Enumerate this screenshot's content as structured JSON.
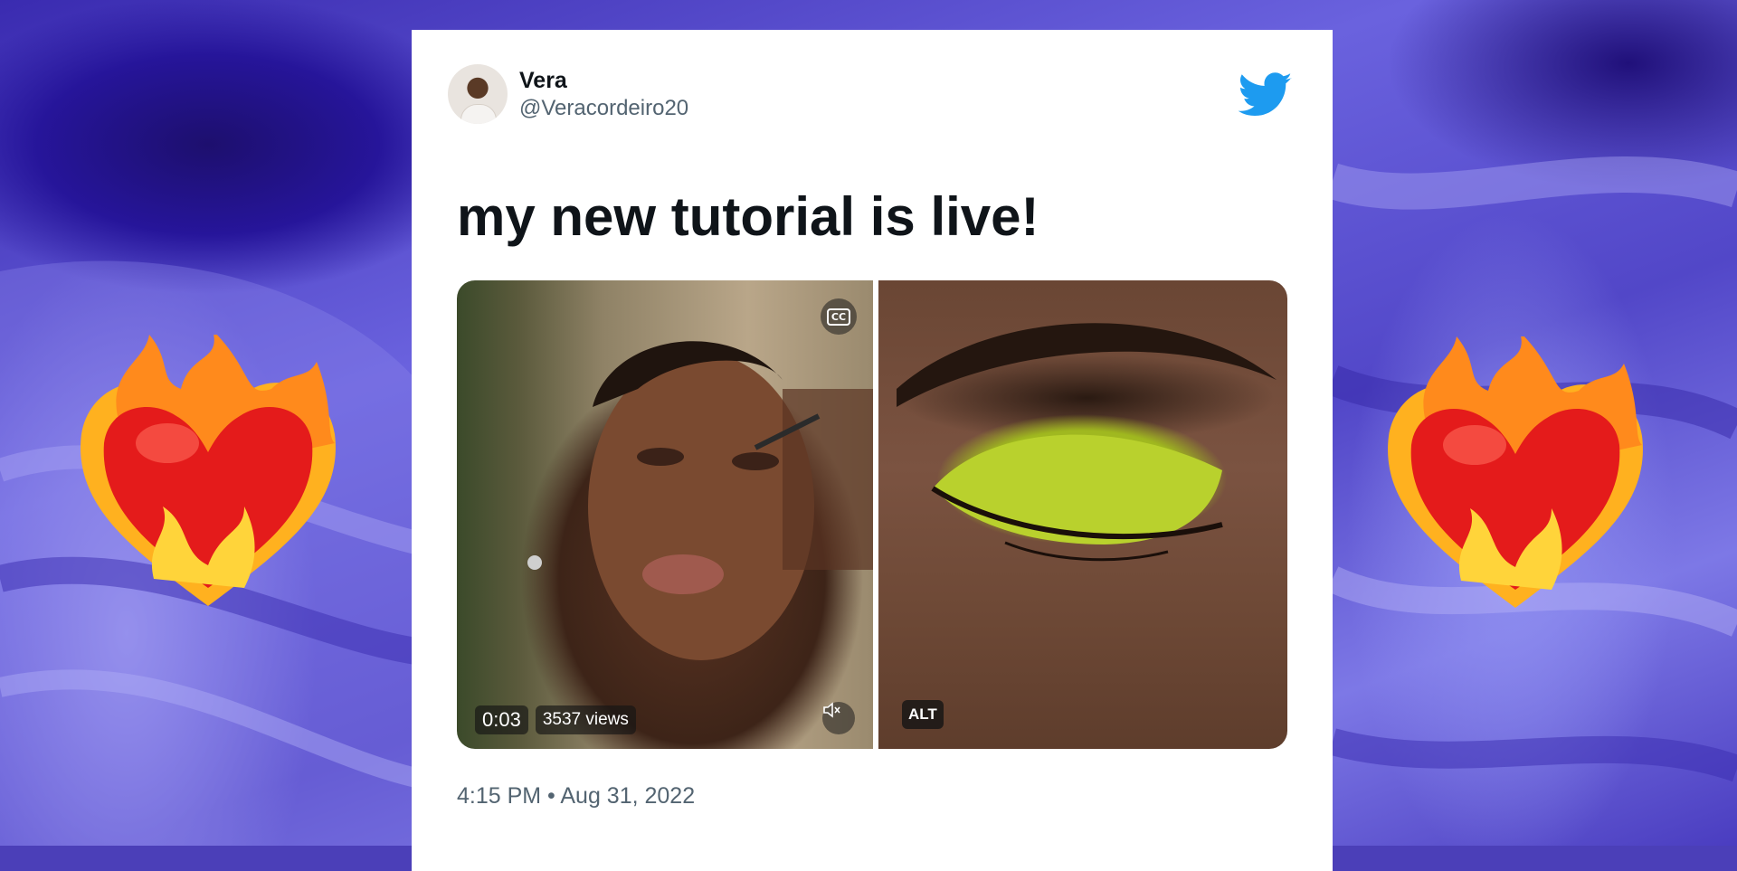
{
  "tweet": {
    "author_name": "Vera",
    "author_handle": "@Veracordeiro20",
    "text": "my new tutorial is live!",
    "timestamp": "4:15 PM • Aug 31, 2022"
  },
  "media": {
    "video": {
      "duration": "0:03",
      "views": "3537 views",
      "captions_label": "CC"
    },
    "image": {
      "alt_label": "ALT"
    }
  },
  "icons": {
    "brand": "twitter-bird-icon",
    "decoration": "heart-on-fire-emoji"
  },
  "colors": {
    "twitter_blue": "#1d9bf0",
    "background_purple": "#4b3fb8",
    "text_primary": "#0f1419",
    "text_secondary": "#536471"
  }
}
